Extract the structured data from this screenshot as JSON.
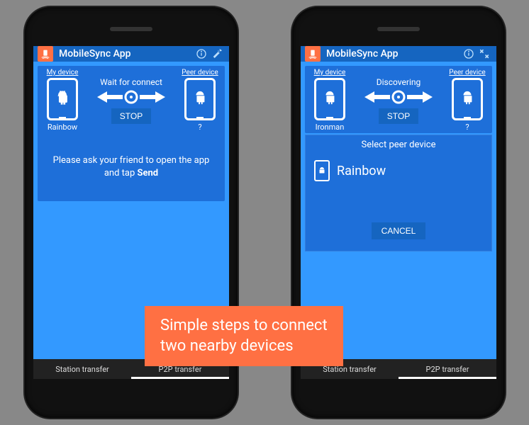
{
  "app_title": "MobileSync App",
  "labels": {
    "my_device": "My device",
    "peer_device": "Peer device",
    "stop": "STOP",
    "unknown_peer": "?"
  },
  "left": {
    "status": "Wait for connect",
    "my_device_name": "Rainbow",
    "instruction_prefix": "Please ask your friend to open the app and tap ",
    "instruction_bold": "Send"
  },
  "right": {
    "status": "Discovering",
    "my_device_name": "Ironman",
    "modal_title": "Select peer device",
    "peer_option": "Rainbow",
    "cancel": "CANCEL"
  },
  "tabs": {
    "station": "Station transfer",
    "p2p": "P2P transfer"
  },
  "banner": {
    "line1": "Simple steps to connect",
    "line2": "two nearby devices"
  }
}
